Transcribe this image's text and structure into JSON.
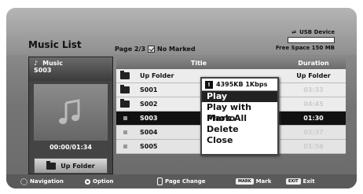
{
  "title": "Music List",
  "page_info": {
    "page": "Page 2/3",
    "marked": "No Marked"
  },
  "usb": {
    "device": "USB Device",
    "free_space": "Free Space 150 MB"
  },
  "left_panel": {
    "folder": "Music",
    "current": "S003",
    "time": "00:00/01:34",
    "up_folder": "Up Folder"
  },
  "list": {
    "headers": {
      "title": "Title",
      "duration": "Duration"
    },
    "rows": [
      {
        "name": "Up Folder",
        "duration": "Up Folder"
      },
      {
        "name": "S001",
        "duration": "03:33"
      },
      {
        "name": "S002",
        "duration": "04:45"
      },
      {
        "name": "S003",
        "duration": "01:30"
      },
      {
        "name": "S004",
        "duration": "02:37"
      },
      {
        "name": "S005",
        "duration": "01:58"
      }
    ]
  },
  "popup": {
    "info": "4395KB 1Kbps",
    "items": [
      "Play",
      "Play with Photo",
      "Mark All",
      "Delete",
      "Close"
    ]
  },
  "bottom": {
    "navigation": "Navigation",
    "option": "Option",
    "page_change": "Page Change",
    "mark_key": "MARK",
    "mark": "Mark",
    "exit_key": "EXIT",
    "exit": "Exit"
  }
}
